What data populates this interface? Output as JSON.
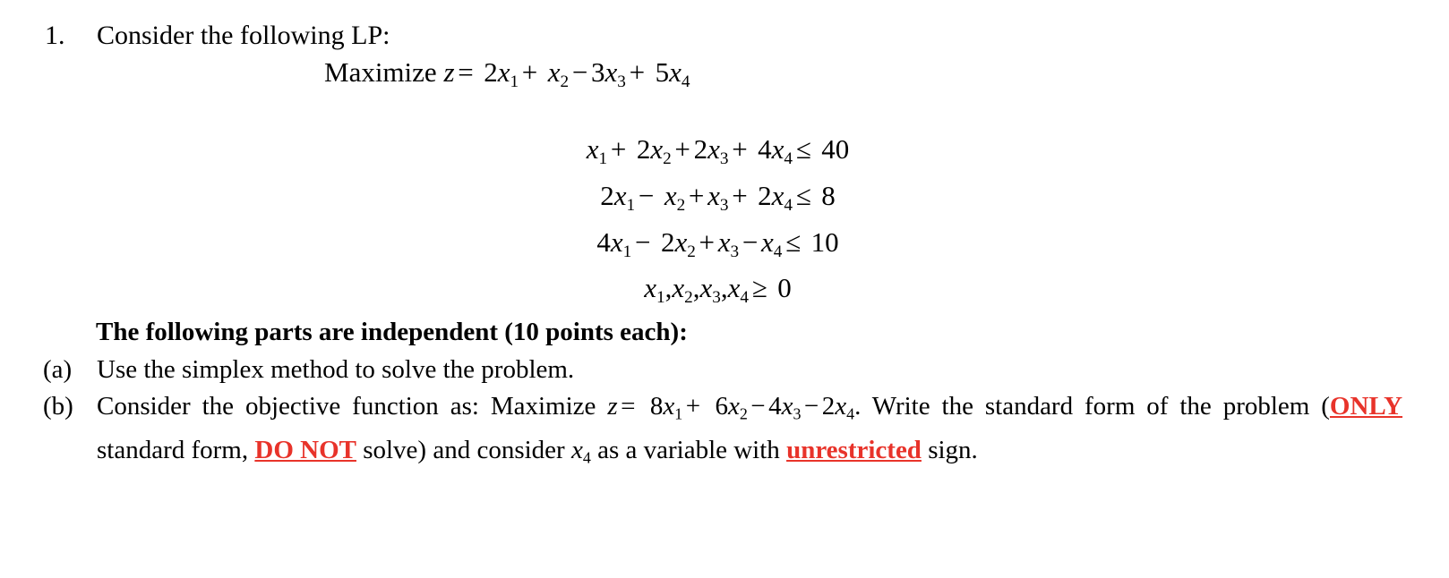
{
  "document": {
    "type": "exam-question",
    "colors": {
      "text": "#000000",
      "emphasis_red": "#E8332A",
      "background": "#FFFFFF"
    },
    "question": {
      "marker": "1.",
      "stem": "Consider the following LP:"
    },
    "objective": {
      "label": "Maximize",
      "variable": "z",
      "equals": "=",
      "terms": [
        {
          "coefficient": "2",
          "variable": "x",
          "subscript": "1",
          "operator": ""
        },
        {
          "coefficient": "",
          "variable": "x",
          "subscript": "2",
          "operator": "+"
        },
        {
          "coefficient": "3",
          "variable": "x",
          "subscript": "3",
          "operator": "−"
        },
        {
          "coefficient": "5",
          "variable": "x",
          "subscript": "4",
          "operator": "+"
        }
      ],
      "plain_text": "Maximize z = 2x₁ + x₂ − 3x₃ + 5x₄"
    },
    "constraints": [
      {
        "terms": [
          {
            "coefficient": "",
            "variable": "x",
            "subscript": "1",
            "operator": ""
          },
          {
            "coefficient": "2",
            "variable": "x",
            "subscript": "2",
            "operator": "+"
          },
          {
            "coefficient": "2",
            "variable": "x",
            "subscript": "3",
            "operator": "+"
          },
          {
            "coefficient": "4",
            "variable": "x",
            "subscript": "4",
            "operator": "+"
          }
        ],
        "relation": "≤",
        "rhs": "40",
        "plain_text": "x₁ + 2x₂ + 2x₃ + 4x₄ ≤ 40"
      },
      {
        "terms": [
          {
            "coefficient": "2",
            "variable": "x",
            "subscript": "1",
            "operator": ""
          },
          {
            "coefficient": "",
            "variable": "x",
            "subscript": "2",
            "operator": "−"
          },
          {
            "coefficient": "",
            "variable": "x",
            "subscript": "3",
            "operator": "+"
          },
          {
            "coefficient": "2",
            "variable": "x",
            "subscript": "4",
            "operator": "+"
          }
        ],
        "relation": "≤",
        "rhs": "8",
        "plain_text": "2x₁ − x₂ + x₃ + 2x₄ ≤ 8"
      },
      {
        "terms": [
          {
            "coefficient": "4",
            "variable": "x",
            "subscript": "1",
            "operator": ""
          },
          {
            "coefficient": "2",
            "variable": "x",
            "subscript": "2",
            "operator": "−"
          },
          {
            "coefficient": "",
            "variable": "x",
            "subscript": "3",
            "operator": "+"
          },
          {
            "coefficient": "",
            "variable": "x",
            "subscript": "4",
            "operator": "−"
          }
        ],
        "relation": "≤",
        "rhs": "10",
        "plain_text": "4x₁ − 2x₂ + x₃ − x₄ ≤ 10"
      }
    ],
    "nonnegativity": {
      "variables": [
        "1",
        "2",
        "3",
        "4"
      ],
      "relation": "≥",
      "rhs": "0",
      "plain_text": "x₁, x₂, x₃, x₄ ≥ 0"
    },
    "parts_heading": "The following parts are independent (10 points each):",
    "parts": [
      {
        "marker": "(a)",
        "text": "Use the simplex method to solve the problem."
      },
      {
        "marker": "(b)",
        "segments": {
          "lead": "Consider the objective function as: Maximize",
          "obj_variable": "z",
          "obj_equals": "=",
          "obj_terms": [
            {
              "coefficient": "8",
              "variable": "x",
              "subscript": "1",
              "operator": ""
            },
            {
              "coefficient": "6",
              "variable": "x",
              "subscript": "2",
              "operator": "+"
            },
            {
              "coefficient": "4",
              "variable": "x",
              "subscript": "3",
              "operator": "−"
            },
            {
              "coefficient": "2",
              "variable": "x",
              "subscript": "4",
              "operator": "−"
            }
          ],
          "obj_plain_text": "Maximize z = 8x₁ + 6x₂ − 4x₃ − 2x₄.",
          "after_period": ". Write the standard form of the problem (",
          "emph_only": "ONLY",
          "mid1": " standard form, ",
          "emph_donot": "DO NOT",
          "mid2": " solve) and consider ",
          "free_variable": "x",
          "free_variable_subscript": "4",
          "mid3": " as a variable with ",
          "emph_unrestricted": "unrestricted",
          "tail": " sign."
        }
      }
    ]
  }
}
